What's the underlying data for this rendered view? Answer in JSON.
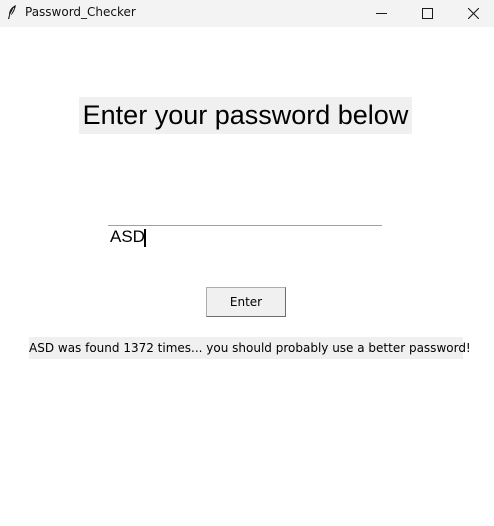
{
  "window": {
    "title": "Password_Checker",
    "icon": "feather-icon",
    "controls": [
      "minimize-icon",
      "maximize-icon",
      "close-icon"
    ]
  },
  "main": {
    "heading": "Enter your password below",
    "password_input": {
      "value": "ASD"
    },
    "enter_button": {
      "label": "Enter"
    },
    "result_message": "ASD was found 1372 times... you should probably use a better password!"
  },
  "colors": {
    "titlebar_bg": "#f3f3f3",
    "label_bg": "#f0f0f0",
    "button_bg": "#f0f0f0",
    "window_bg": "#ffffff"
  }
}
